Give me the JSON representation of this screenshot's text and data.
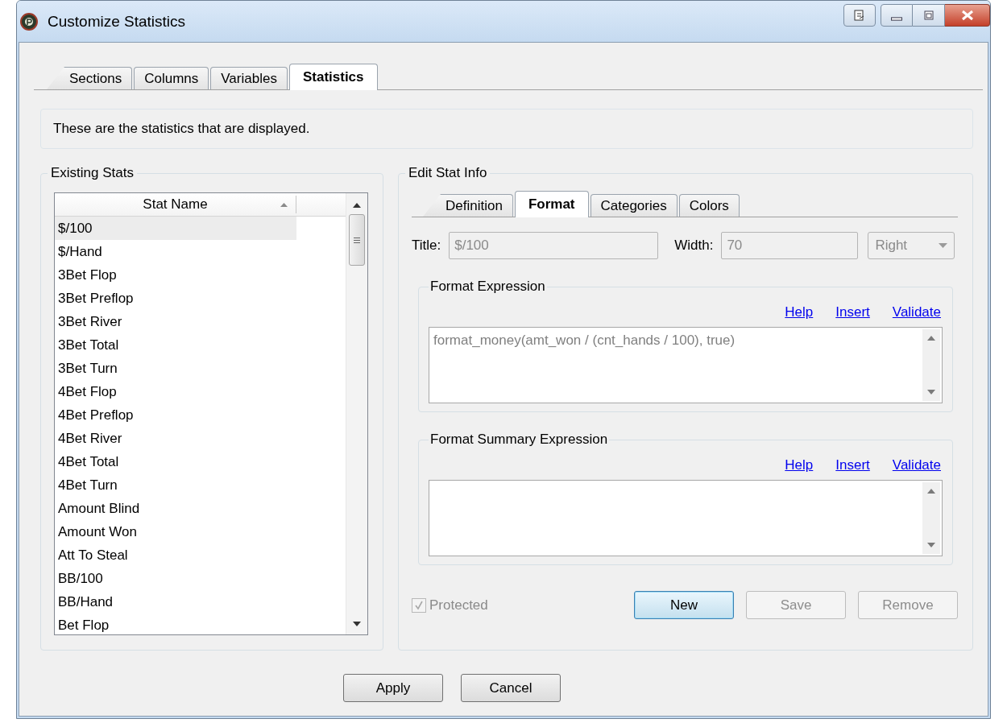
{
  "window": {
    "title": "Customize Statistics"
  },
  "tabs": [
    {
      "label": "Sections",
      "selected": false
    },
    {
      "label": "Columns",
      "selected": false
    },
    {
      "label": "Variables",
      "selected": false
    },
    {
      "label": "Statistics",
      "selected": true
    }
  ],
  "description": "These are the statistics that are displayed.",
  "existing_stats": {
    "title": "Existing Stats",
    "column": "Stat Name",
    "rows": [
      {
        "name": "$/100",
        "selected": true
      },
      {
        "name": "$/Hand",
        "selected": false
      },
      {
        "name": "3Bet Flop",
        "selected": false
      },
      {
        "name": "3Bet Preflop",
        "selected": false
      },
      {
        "name": "3Bet River",
        "selected": false
      },
      {
        "name": "3Bet Total",
        "selected": false
      },
      {
        "name": "3Bet Turn",
        "selected": false
      },
      {
        "name": "4Bet Flop",
        "selected": false
      },
      {
        "name": "4Bet Preflop",
        "selected": false
      },
      {
        "name": "4Bet River",
        "selected": false
      },
      {
        "name": "4Bet Total",
        "selected": false
      },
      {
        "name": "4Bet Turn",
        "selected": false
      },
      {
        "name": "Amount Blind",
        "selected": false
      },
      {
        "name": "Amount Won",
        "selected": false
      },
      {
        "name": "Att To Steal",
        "selected": false
      },
      {
        "name": "BB/100",
        "selected": false
      },
      {
        "name": "BB/Hand",
        "selected": false
      },
      {
        "name": "Bet Flop",
        "selected": false
      }
    ]
  },
  "edit_stat_info": {
    "title": "Edit Stat Info",
    "tabs": [
      {
        "label": "Definition",
        "selected": false
      },
      {
        "label": "Format",
        "selected": true
      },
      {
        "label": "Categories",
        "selected": false
      },
      {
        "label": "Colors",
        "selected": false
      }
    ],
    "title_field": {
      "label": "Title:",
      "value": "$/100",
      "disabled": true
    },
    "width_field": {
      "label": "Width:",
      "value": "70",
      "disabled": true
    },
    "alignment": {
      "value": "Right",
      "disabled": true
    },
    "expressions": [
      {
        "title": "Format Expression",
        "links": [
          "Help",
          "Insert",
          "Validate"
        ],
        "value": "format_money(amt_won / (cnt_hands / 100), true)"
      },
      {
        "title": "Format Summary Expression",
        "links": [
          "Help",
          "Insert",
          "Validate"
        ]
      }
    ],
    "protected": {
      "label": "Protected",
      "checked": true,
      "disabled": true
    },
    "buttons": [
      {
        "label": "New",
        "disabled": false,
        "focused": true
      },
      {
        "label": "Save",
        "disabled": true,
        "focused": false
      },
      {
        "label": "Remove",
        "disabled": true,
        "focused": false
      }
    ]
  },
  "buttons": [
    {
      "label": "Apply"
    },
    {
      "label": "Cancel"
    }
  ]
}
